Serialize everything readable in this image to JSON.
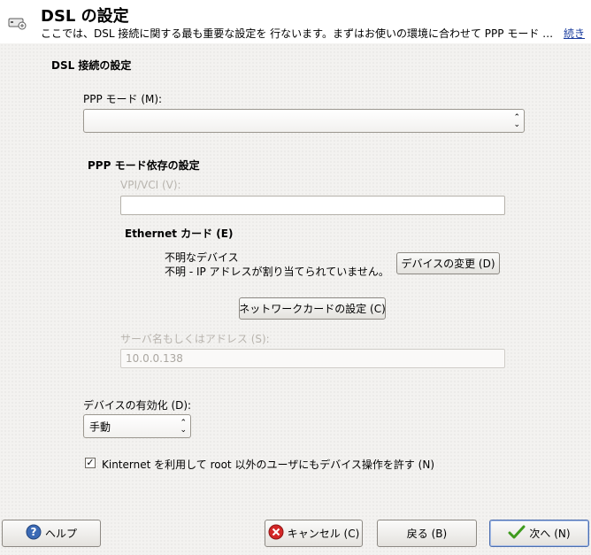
{
  "header": {
    "title": "DSL の設定",
    "description": "ここでは、DSL 接続に関する最も重要な設定を 行ないます。まずはお使いの環境に合わせて PPP モード …",
    "more_link": "続き"
  },
  "dsl_section": {
    "title": "DSL 接続の設定",
    "ppp_mode_label": "PPP モード (M):",
    "ppp_mode_value": ""
  },
  "ppp_dependent": {
    "title": "PPP モード依存の設定",
    "vpi_vci_label": "VPI/VCI (V):",
    "vpi_vci_value": "",
    "ethernet_title": "Ethernet カード (E)",
    "unknown_device": "不明なデバイス",
    "unknown_ip": "不明 - IP アドレスが割り当てられていません。",
    "change_device_button": "デバイスの変更 (D)",
    "nic_settings_button": "ネットワークカードの設定 (C)",
    "server_label": "サーバ名もしくはアドレス (S):",
    "server_value": "10.0.0.138"
  },
  "activation": {
    "label": "デバイスの有効化 (D):",
    "value": "手動"
  },
  "kinternet": {
    "label": "Kinternet を利用して root 以外のユーザにもデバイス操作を許す (N)",
    "checked": true
  },
  "footer": {
    "help_button": "ヘルプ",
    "cancel_button": "キャンセル (C)",
    "back_button": "戻る (B)",
    "next_button": "次へ (N)"
  }
}
